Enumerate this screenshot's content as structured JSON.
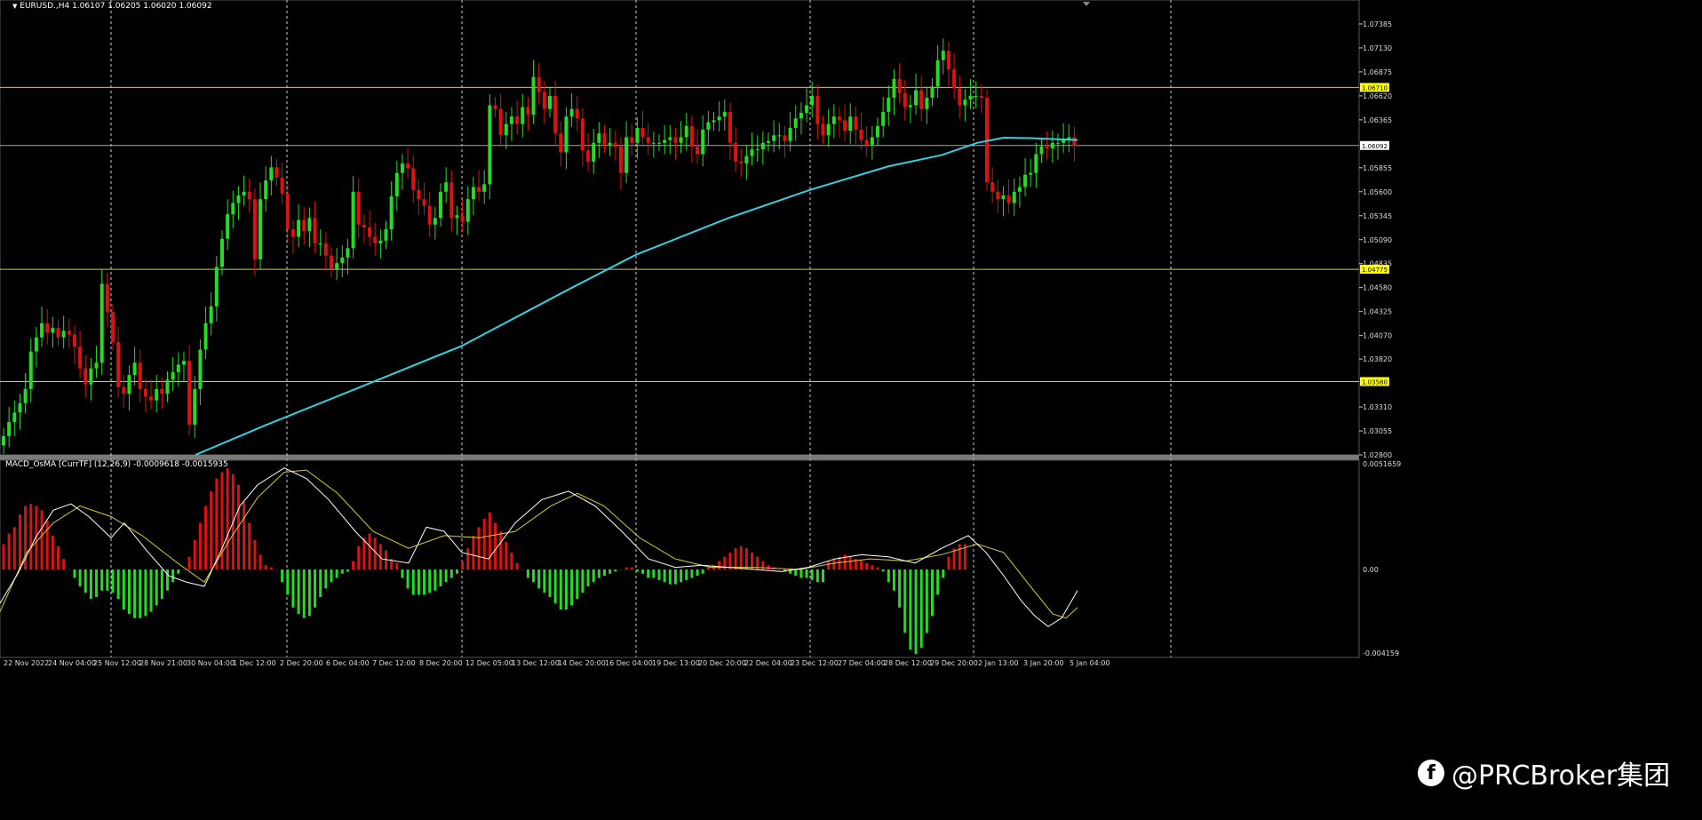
{
  "header": {
    "symbol_line": "EURUSD.,H4  1.06107 1.06205 1.06020 1.06092",
    "indicator_line": "MACD_OsMA [CurrTF] (12,26,9) -0.0009618 -0.0015935"
  },
  "watermark": {
    "icon": "facebook-icon",
    "text": "@PRCBroker集团"
  },
  "colors": {
    "background": "#000000",
    "bull": "#22dd22",
    "bear": "#dd1111",
    "ma": "#33d1e0",
    "hline": "#d4c84a",
    "price_tag_bg": "#ffff00",
    "current_tag_bg": "#ffffff",
    "macd_line": "#ffffff",
    "signal_line": "#d8d020"
  },
  "chart_data": [
    {
      "type": "candlestick",
      "title": "EURUSD.,H4",
      "ylim": [
        1.028,
        1.0764
      ],
      "y_ticks": [
        "1.07385",
        "1.07130",
        "1.06875",
        "1.06620",
        "1.06365",
        "1.05855",
        "1.05600",
        "1.05345",
        "1.05090",
        "1.04835",
        "1.04580",
        "1.04325",
        "1.04070",
        "1.03820",
        "1.03310",
        "1.03055",
        "1.02800"
      ],
      "x_ticks": [
        "22 Nov 2022",
        "24 Nov 04:00",
        "25 Nov 12:00",
        "28 Nov 21:00",
        "30 Nov 04:00",
        "1 Dec 12:00",
        "2 Dec 20:00",
        "6 Dec 04:00",
        "7 Dec 12:00",
        "8 Dec 20:00",
        "12 Dec 05:00",
        "13 Dec 12:00",
        "14 Dec 20:00",
        "16 Dec 04:00",
        "19 Dec 13:00",
        "20 Dec 20:00",
        "22 Dec 04:00",
        "23 Dec 12:00",
        "27 Dec 04:00",
        "28 Dec 12:00",
        "29 Dec 20:00",
        "2 Jan 13:00",
        "3 Jan 20:00",
        "5 Jan 04:00"
      ],
      "horizontal_lines": [
        {
          "price": 1.0671,
          "label": "1.06710"
        },
        {
          "price": 1.04775,
          "label": "1.04775"
        },
        {
          "price": 1.0358,
          "label": "1.03580"
        },
        {
          "price": 1.06092,
          "label": "1.06092",
          "current": true
        }
      ],
      "period_separators": [
        125,
        323,
        520,
        716,
        912,
        1096,
        1318
      ],
      "closes": [
        1.03,
        1.0315,
        1.0325,
        1.0335,
        1.035,
        1.039,
        1.0405,
        1.042,
        1.041,
        1.0415,
        1.0405,
        1.0412,
        1.0408,
        1.0395,
        1.0372,
        1.0355,
        1.0372,
        1.0378,
        1.0462,
        1.0432,
        1.04,
        1.0352,
        1.0345,
        1.0365,
        1.0378,
        1.035,
        1.0342,
        1.0338,
        1.035,
        1.0345,
        1.036,
        1.0368,
        1.0376,
        1.038,
        1.0312,
        1.035,
        1.0392,
        1.042,
        1.0438,
        1.048,
        1.051,
        1.0536,
        1.0548,
        1.0556,
        1.056,
        1.0552,
        1.0488,
        1.0552,
        1.0572,
        1.0586,
        1.0575,
        1.0558,
        1.052,
        1.0512,
        1.053,
        1.0518,
        1.0532,
        1.0505,
        1.0505,
        1.0492,
        1.0478,
        1.0484,
        1.049,
        1.05,
        1.056,
        1.0525,
        1.0522,
        1.0512,
        1.0505,
        1.0508,
        1.052,
        1.0555,
        1.058,
        1.059,
        1.0585,
        1.0562,
        1.0552,
        1.0545,
        1.0525,
        1.0532,
        1.056,
        1.057,
        1.0532,
        1.0535,
        1.0528,
        1.0552,
        1.0565,
        1.056,
        1.0568,
        1.0652,
        1.0648,
        1.062,
        1.0632,
        1.064,
        1.0632,
        1.065,
        1.0642,
        1.0682,
        1.0666,
        1.0648,
        1.0662,
        1.0622,
        1.0602,
        1.064,
        1.0648,
        1.0638,
        1.0604,
        1.0592,
        1.0612,
        1.0622,
        1.061,
        1.0612,
        1.0608,
        1.058,
        1.0618,
        1.0612,
        1.0628,
        1.0618,
        1.0612,
        1.0612,
        1.0612,
        1.0615,
        1.0618,
        1.0612,
        1.0618,
        1.063,
        1.0608,
        1.06,
        1.0626,
        1.0634,
        1.0636,
        1.064,
        1.0645,
        1.0612,
        1.0592,
        1.059,
        1.0598,
        1.0605,
        1.0605,
        1.0612,
        1.0614,
        1.062,
        1.062,
        1.0614,
        1.0628,
        1.0638,
        1.0644,
        1.0652,
        1.0662,
        1.0632,
        1.062,
        1.0632,
        1.064,
        1.0636,
        1.0625,
        1.064,
        1.0626,
        1.0615,
        1.061,
        1.0618,
        1.063,
        1.0645,
        1.066,
        1.068,
        1.0665,
        1.065,
        1.0652,
        1.0668,
        1.0648,
        1.066,
        1.0672,
        1.07,
        1.071,
        1.069,
        1.067,
        1.0652,
        1.0658,
        1.0662,
        1.0662,
        1.066,
        1.057,
        1.056,
        1.0552,
        1.0556,
        1.0548,
        1.056,
        1.0565,
        1.0578,
        1.058,
        1.06,
        1.0608,
        1.0606,
        1.0612,
        1.0612,
        1.0616,
        1.0618,
        1.0609
      ],
      "ma_curve": [
        [
          220,
          1.028
        ],
        [
          300,
          1.0312
        ],
        [
          400,
          1.035
        ],
        [
          520,
          1.0396
        ],
        [
          640,
          1.0456
        ],
        [
          716,
          1.0493
        ],
        [
          820,
          1.0532
        ],
        [
          912,
          1.0562
        ],
        [
          1000,
          1.0587
        ],
        [
          1060,
          1.0599
        ],
        [
          1100,
          1.0612
        ],
        [
          1130,
          1.06175
        ],
        [
          1160,
          1.0617
        ],
        [
          1213,
          1.0615
        ]
      ]
    },
    {
      "type": "macd_osma",
      "title": "MACD_OsMA [CurrTF] (12,26,9)",
      "y_ticks": [
        "0.0051659",
        "0.00",
        "-0.004159"
      ],
      "ylim": [
        -0.004159,
        0.0051659
      ],
      "histogram": [
        0.0012,
        0.0017,
        0.002,
        0.0026,
        0.003,
        0.0031,
        0.003,
        0.0028,
        0.0023,
        0.0016,
        0.0011,
        0.0005,
        0.0,
        -0.0004,
        -0.0008,
        -0.0011,
        -0.0014,
        -0.0013,
        -0.001,
        -0.001,
        -0.0011,
        -0.0014,
        -0.0019,
        -0.0021,
        -0.0023,
        -0.0023,
        -0.0022,
        -0.002,
        -0.0017,
        -0.0014,
        -0.001,
        -0.0006,
        -0.0002,
        -0.0,
        0.0006,
        0.0014,
        0.0022,
        0.003,
        0.0037,
        0.0043,
        0.0046,
        0.0048,
        0.0045,
        0.004,
        0.0032,
        0.0022,
        0.0014,
        0.0007,
        0.0002,
        0.0001,
        0.0,
        -0.0006,
        -0.0012,
        -0.0018,
        -0.0021,
        -0.0023,
        -0.0022,
        -0.0018,
        -0.0013,
        -0.0009,
        -0.0006,
        -0.0004,
        -0.0002,
        -0.0001,
        0.0004,
        0.0011,
        0.0015,
        0.0017,
        0.0015,
        0.0012,
        0.0009,
        0.0005,
        0.0003,
        -0.0004,
        -0.0009,
        -0.0012,
        -0.0012,
        -0.0012,
        -0.0011,
        -0.001,
        -0.0008,
        -0.0006,
        -0.0004,
        -0.0002,
        0.0004,
        0.001,
        0.0016,
        0.002,
        0.0024,
        0.0027,
        0.0022,
        0.0018,
        0.0013,
        0.0008,
        0.0003,
        0.0,
        -0.0004,
        -0.0006,
        -0.0009,
        -0.0011,
        -0.0013,
        -0.0016,
        -0.0019,
        -0.0019,
        -0.0017,
        -0.0014,
        -0.0011,
        -0.0008,
        -0.0006,
        -0.0004,
        -0.0003,
        -0.0002,
        -0.0001,
        -0.0,
        0.0001,
        0.0001,
        -0.0001,
        -0.0002,
        -0.0004,
        -0.0004,
        -0.0005,
        -0.0006,
        -0.0007,
        -0.0007,
        -0.0006,
        -0.0005,
        -0.0004,
        -0.0003,
        -0.0002,
        0.0001,
        0.0002,
        0.0004,
        0.0006,
        0.0008,
        0.001,
        0.0011,
        0.001,
        0.0008,
        0.0006,
        0.0004,
        0.0002,
        0.0001,
        0.0,
        -0.0001,
        -0.0002,
        -0.0003,
        -0.0004,
        -0.0004,
        -0.0005,
        -0.0006,
        -0.0006,
        0.0004,
        0.0005,
        0.0006,
        0.0007,
        0.0006,
        0.0005,
        0.0004,
        0.0003,
        0.0002,
        0.0001,
        -0.0001,
        -0.0006,
        -0.001,
        -0.0018,
        -0.003,
        -0.0038,
        -0.004,
        -0.0037,
        -0.003,
        -0.0022,
        -0.0012,
        -0.0004,
        0.0006,
        0.001,
        0.0012,
        0.0012
      ],
      "macd_line": [
        [
          0,
          -0.0016
        ],
        [
          20,
          -0.0002
        ],
        [
          40,
          0.0015
        ],
        [
          60,
          0.0028
        ],
        [
          80,
          0.0031
        ],
        [
          100,
          0.0025
        ],
        [
          125,
          0.0015
        ],
        [
          140,
          0.0022
        ],
        [
          165,
          0.0009
        ],
        [
          190,
          -0.0003
        ],
        [
          210,
          -0.0006
        ],
        [
          230,
          -0.0008
        ],
        [
          250,
          0.001
        ],
        [
          270,
          0.003
        ],
        [
          290,
          0.004
        ],
        [
          320,
          0.0048
        ],
        [
          345,
          0.0043
        ],
        [
          370,
          0.0033
        ],
        [
          400,
          0.0018
        ],
        [
          430,
          0.0005
        ],
        [
          460,
          0.0003
        ],
        [
          480,
          0.002
        ],
        [
          500,
          0.0018
        ],
        [
          520,
          0.0008
        ],
        [
          550,
          0.0005
        ],
        [
          580,
          0.0022
        ],
        [
          610,
          0.0033
        ],
        [
          640,
          0.0037
        ],
        [
          670,
          0.003
        ],
        [
          700,
          0.0018
        ],
        [
          730,
          0.0005
        ],
        [
          760,
          0.0001
        ],
        [
          790,
          0.0002
        ],
        [
          820,
          0.0001
        ],
        [
          850,
          0.0
        ],
        [
          880,
          -0.0001
        ],
        [
          910,
          0.0001
        ],
        [
          940,
          0.0005
        ],
        [
          970,
          0.0007
        ],
        [
          1000,
          0.0006
        ],
        [
          1030,
          0.0003
        ],
        [
          1060,
          0.001
        ],
        [
          1090,
          0.0016
        ],
        [
          1110,
          0.0008
        ],
        [
          1130,
          -0.0003
        ],
        [
          1150,
          -0.0015
        ],
        [
          1165,
          -0.0022
        ],
        [
          1180,
          -0.0027
        ],
        [
          1195,
          -0.0023
        ],
        [
          1213,
          -0.001
        ]
      ],
      "signal_line": [
        [
          0,
          -0.002
        ],
        [
          30,
          0.0008
        ],
        [
          60,
          0.0022
        ],
        [
          90,
          0.003
        ],
        [
          125,
          0.0025
        ],
        [
          160,
          0.0016
        ],
        [
          200,
          0.0003
        ],
        [
          230,
          -0.0006
        ],
        [
          260,
          0.0015
        ],
        [
          290,
          0.0034
        ],
        [
          320,
          0.0046
        ],
        [
          345,
          0.0047
        ],
        [
          380,
          0.0036
        ],
        [
          420,
          0.0018
        ],
        [
          460,
          0.001
        ],
        [
          500,
          0.0016
        ],
        [
          540,
          0.0015
        ],
        [
          580,
          0.0018
        ],
        [
          620,
          0.003
        ],
        [
          650,
          0.0036
        ],
        [
          680,
          0.003
        ],
        [
          720,
          0.0015
        ],
        [
          760,
          0.0005
        ],
        [
          800,
          0.0001
        ],
        [
          850,
          0.0001
        ],
        [
          900,
          0.0
        ],
        [
          940,
          0.0003
        ],
        [
          980,
          0.0005
        ],
        [
          1020,
          0.0004
        ],
        [
          1060,
          0.0007
        ],
        [
          1100,
          0.0012
        ],
        [
          1130,
          0.0008
        ],
        [
          1160,
          -0.0008
        ],
        [
          1185,
          -0.0021
        ],
        [
          1200,
          -0.0023
        ],
        [
          1213,
          -0.0018
        ]
      ]
    }
  ]
}
